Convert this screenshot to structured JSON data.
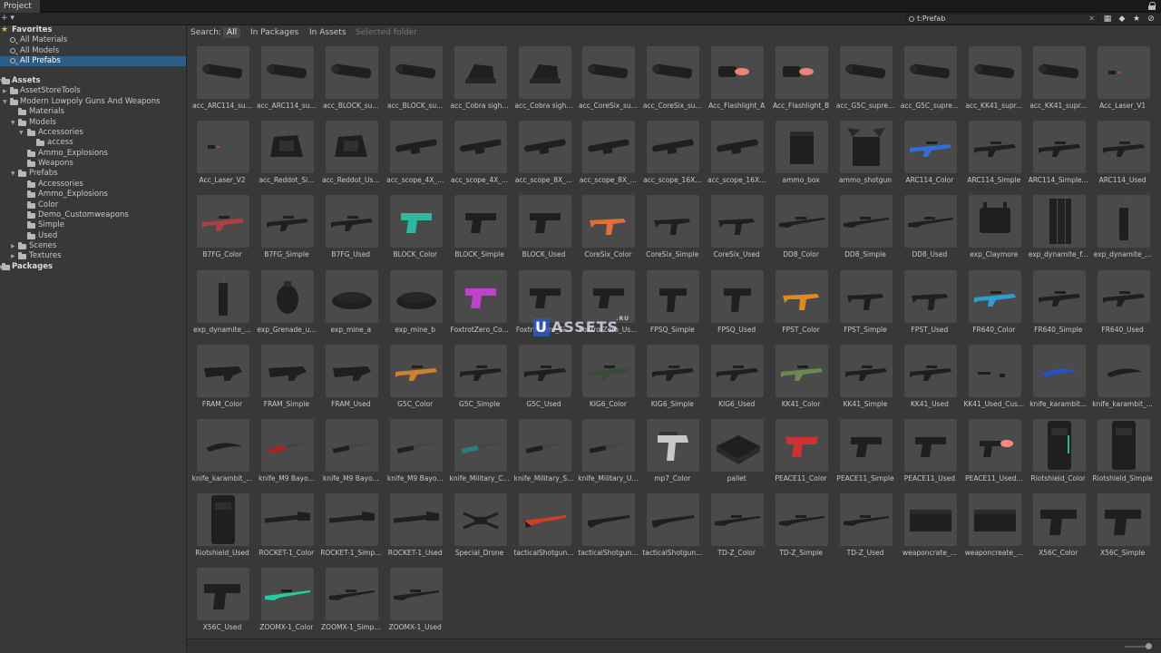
{
  "window": {
    "tab_label": "Project",
    "lock_icon": "lock-icon"
  },
  "toolbar": {
    "create_label": "+ ▾",
    "search_value": "t:Prefab",
    "clear_glyph": "✕",
    "icons": [
      "scene-filter-icon",
      "type-filter-icon",
      "label-filter-icon",
      "favorite-star-icon",
      "hidden-packages-icon"
    ],
    "icon_glyphs": [
      "▦",
      "◆",
      "●",
      "★",
      "⊘"
    ]
  },
  "sidebar": {
    "favorites_label": "Favorites",
    "favorites": [
      "All Materials",
      "All Models",
      "All Prefabs"
    ],
    "assets_label": "Assets",
    "tree": [
      "AssetStoreTools",
      "Modern Lowpoly Guns And Weapons",
      "Materials",
      "Models",
      "Accessories",
      "access",
      "Ammo_Explosions",
      "Weapons",
      "Prefabs",
      "Accessories",
      "Ammo_Explosions",
      "Color",
      "Demo_Customweapons",
      "Simple",
      "Used",
      "Scenes",
      "Textures"
    ],
    "packages_label": "Packages"
  },
  "search": {
    "label": "Search:",
    "scopes": [
      "All",
      "In Packages",
      "In Assets",
      "Selected folder"
    ]
  },
  "assets": [
    {
      "label": "acc_ARC114_su...",
      "kind": "silencer"
    },
    {
      "label": "acc_ARC114_su...",
      "kind": "silencer"
    },
    {
      "label": "acc_BLOCK_su...",
      "kind": "silencer"
    },
    {
      "label": "acc_BLOCK_su...",
      "kind": "silencer"
    },
    {
      "label": "acc_Cobra sigh...",
      "kind": "sight"
    },
    {
      "label": "acc_Cobra sigh...",
      "kind": "sight"
    },
    {
      "label": "acc_CoreSix_su...",
      "kind": "silencer"
    },
    {
      "label": "acc_CoreSix_su...",
      "kind": "silencer"
    },
    {
      "label": "Acc_Flashlight_A",
      "kind": "flashlight"
    },
    {
      "label": "Acc_Flashlight_B",
      "kind": "flashlight"
    },
    {
      "label": "acc_G5C_supre...",
      "kind": "silencer"
    },
    {
      "label": "acc_G5C_supre...",
      "kind": "silencer"
    },
    {
      "label": "acc_KK41_supr...",
      "kind": "silencer"
    },
    {
      "label": "acc_KK41_supr...",
      "kind": "silencer"
    },
    {
      "label": "Acc_Laser_V1",
      "kind": "laser"
    },
    {
      "label": "Acc_Laser_V2",
      "kind": "laser"
    },
    {
      "label": "acc_Reddot_Si...",
      "kind": "reddot"
    },
    {
      "label": "acc_Reddot_Us...",
      "kind": "reddot"
    },
    {
      "label": "acc_scope_4X_...",
      "kind": "scope"
    },
    {
      "label": "acc_scope_4X_...",
      "kind": "scope"
    },
    {
      "label": "acc_scope_8X_...",
      "kind": "scope"
    },
    {
      "label": "acc_scope_8X_...",
      "kind": "scope"
    },
    {
      "label": "acc_scope_16X...",
      "kind": "scope"
    },
    {
      "label": "acc_scope_16X...",
      "kind": "scope"
    },
    {
      "label": "ammo_box",
      "kind": "box"
    },
    {
      "label": "ammo_shotgun",
      "kind": "openbox"
    },
    {
      "label": "ARC114_Color",
      "kind": "rifle",
      "color": "#2f6fd6"
    },
    {
      "label": "ARC114_Simple",
      "kind": "rifle"
    },
    {
      "label": "ARC114_Simple...",
      "kind": "rifle"
    },
    {
      "label": "ARC114_Used",
      "kind": "rifle"
    },
    {
      "label": "B7FG_Color",
      "kind": "rifle",
      "color": "#b04040"
    },
    {
      "label": "B7FG_Simple",
      "kind": "rifle"
    },
    {
      "label": "B7FG_Used",
      "kind": "rifle"
    },
    {
      "label": "BLOCK_Color",
      "kind": "pistol",
      "color": "#2fb8a0"
    },
    {
      "label": "BLOCK_Simple",
      "kind": "pistol"
    },
    {
      "label": "BLOCK_Used",
      "kind": "pistol"
    },
    {
      "label": "CoreSix_Color",
      "kind": "smg",
      "color": "#e0703a"
    },
    {
      "label": "CoreSix_Simple",
      "kind": "smg"
    },
    {
      "label": "CoreSix_Used",
      "kind": "smg"
    },
    {
      "label": "DD8_Color",
      "kind": "sniper"
    },
    {
      "label": "DD8_Simple",
      "kind": "sniper"
    },
    {
      "label": "DD8_Used",
      "kind": "sniper"
    },
    {
      "label": "exp_Claymore",
      "kind": "claymore"
    },
    {
      "label": "exp_dynamite_f...",
      "kind": "dynamitebundle"
    },
    {
      "label": "exp_dynamite_...",
      "kind": "dynamite"
    },
    {
      "label": "exp_dynamite_...",
      "kind": "dynamite"
    },
    {
      "label": "exp_Grenade_u...",
      "kind": "grenade"
    },
    {
      "label": "exp_mine_a",
      "kind": "mine"
    },
    {
      "label": "exp_mine_b",
      "kind": "mine"
    },
    {
      "label": "FoxtrotZero_Co...",
      "kind": "pistol",
      "color": "#c040d0"
    },
    {
      "label": "FoxtrotZero_Si...",
      "kind": "pistol"
    },
    {
      "label": "FoxtrotZero_Us...",
      "kind": "pistol"
    },
    {
      "label": "FPSQ_Simple",
      "kind": "machinepistol"
    },
    {
      "label": "FPSQ_Used",
      "kind": "machinepistol"
    },
    {
      "label": "FPST_Color",
      "kind": "smg",
      "color": "#e08a20"
    },
    {
      "label": "FPST_Simple",
      "kind": "smg"
    },
    {
      "label": "FPST_Used",
      "kind": "smg"
    },
    {
      "label": "FR640_Color",
      "kind": "rifle",
      "color": "#2aa0d0"
    },
    {
      "label": "FR640_Simple",
      "kind": "rifle"
    },
    {
      "label": "FR640_Used",
      "kind": "rifle"
    },
    {
      "label": "FRAM_Color",
      "kind": "bullpup"
    },
    {
      "label": "FRAM_Simple",
      "kind": "bullpup"
    },
    {
      "label": "FRAM_Used",
      "kind": "bullpup"
    },
    {
      "label": "G5C_Color",
      "kind": "rifle",
      "color": "#d08030"
    },
    {
      "label": "G5C_Simple",
      "kind": "rifle"
    },
    {
      "label": "G5C_Used",
      "kind": "rifle"
    },
    {
      "label": "KIG6_Color",
      "kind": "rifle",
      "color": "#3a4a3a"
    },
    {
      "label": "KIG6_Simple",
      "kind": "rifle"
    },
    {
      "label": "KIG6_Used",
      "kind": "rifle"
    },
    {
      "label": "KK41_Color",
      "kind": "rifle",
      "color": "#6a8a50"
    },
    {
      "label": "KK41_Simple",
      "kind": "rifle"
    },
    {
      "label": "KK41_Used",
      "kind": "rifle"
    },
    {
      "label": "KK41_Used_Cus...",
      "kind": "rifleparts"
    },
    {
      "label": "knife_karambit...",
      "kind": "karambit",
      "color": "#2a50c0"
    },
    {
      "label": "knife_karambit_...",
      "kind": "karambit"
    },
    {
      "label": "knife_karambit_...",
      "kind": "karambit"
    },
    {
      "label": "knife_M9 Bayo...",
      "kind": "knife",
      "color": "#b02020"
    },
    {
      "label": "knife_M9 Bayo...",
      "kind": "knife"
    },
    {
      "label": "knife_M9 Bayo...",
      "kind": "knife"
    },
    {
      "label": "knife_Military_C...",
      "kind": "knife",
      "color": "#2a8080"
    },
    {
      "label": "knife_Military_S...",
      "kind": "knife"
    },
    {
      "label": "knife_Military_U...",
      "kind": "knife"
    },
    {
      "label": "mp7_Color",
      "kind": "mp7",
      "color": "#c8c8c8"
    },
    {
      "label": "pallet",
      "kind": "pallet"
    },
    {
      "label": "PEACE11_Color",
      "kind": "pistol",
      "color": "#d03030"
    },
    {
      "label": "PEACE11_Simple",
      "kind": "pistol"
    },
    {
      "label": "PEACE11_Used",
      "kind": "pistol"
    },
    {
      "label": "PEACE11_Used...",
      "kind": "flashpistol"
    },
    {
      "label": "Riotshield_Color",
      "kind": "shield",
      "color": "#20c080"
    },
    {
      "label": "Riotshield_Simple",
      "kind": "shield"
    },
    {
      "label": "Riotshield_Used",
      "kind": "shield"
    },
    {
      "label": "ROCKET-1_Color",
      "kind": "rpg"
    },
    {
      "label": "ROCKET-1_Simp...",
      "kind": "rpg"
    },
    {
      "label": "ROCKET-1_Used",
      "kind": "rpg"
    },
    {
      "label": "Special_Drone",
      "kind": "drone"
    },
    {
      "label": "tacticalShotgun...",
      "kind": "shotgun",
      "color": "#d04020"
    },
    {
      "label": "tacticalShotgun...",
      "kind": "shotgun"
    },
    {
      "label": "tacticalShotgun...",
      "kind": "shotgun"
    },
    {
      "label": "TD-Z_Color",
      "kind": "sniper"
    },
    {
      "label": "TD-Z_Simple",
      "kind": "sniper"
    },
    {
      "label": "TD-Z_Used",
      "kind": "sniper"
    },
    {
      "label": "weaponcrate_...",
      "kind": "crate"
    },
    {
      "label": "weaponcreate_...",
      "kind": "crate"
    },
    {
      "label": "X56C_Color",
      "kind": "bigpistol"
    },
    {
      "label": "X56C_Simple",
      "kind": "bigpistol"
    },
    {
      "label": "X56C_Used",
      "kind": "bigpistol"
    },
    {
      "label": "ZOOMX-1_Color",
      "kind": "sniper",
      "color": "#20d0a0"
    },
    {
      "label": "ZOOMX-1_Simp...",
      "kind": "sniper"
    },
    {
      "label": "ZOOMX-1_Used",
      "kind": "sniper"
    }
  ],
  "watermark": {
    "u": "U",
    "text": "ASSETS",
    "suffix": ".RU"
  },
  "status": {
    "zoom_icon": "zoom-slider"
  }
}
